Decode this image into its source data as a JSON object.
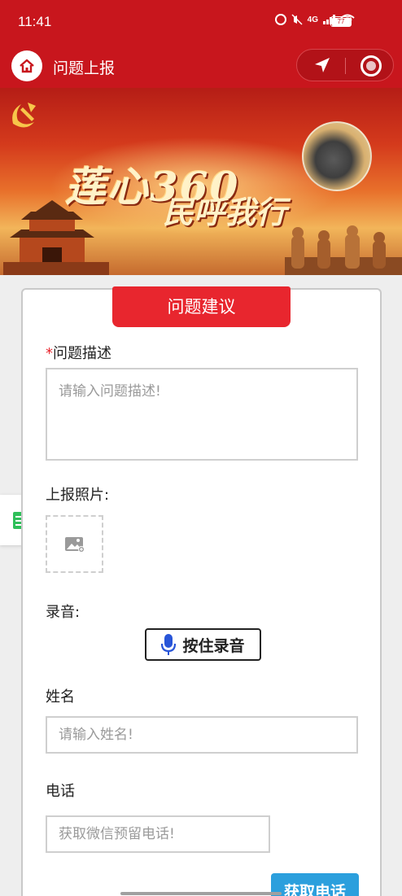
{
  "status_bar": {
    "time": "11:41",
    "network": "4G",
    "battery": "77"
  },
  "nav": {
    "title": "问题上报"
  },
  "banner": {
    "slogan_line1": "莲心360",
    "slogan_line2": "民呼我行"
  },
  "form": {
    "tab_title": "问题建议",
    "description": {
      "required_mark": "*",
      "label": "问题描述",
      "placeholder": "请输入问题描述!"
    },
    "photo": {
      "label": "上报照片:"
    },
    "recording": {
      "label": "录音:",
      "button": "按住录音"
    },
    "name": {
      "label": "姓名",
      "placeholder": "请输入姓名!"
    },
    "phone": {
      "label": "电话",
      "placeholder": "获取微信预留电话!",
      "fetch_button": "获取电话"
    }
  },
  "colors": {
    "brand_red": "#c8161d",
    "tab_red": "#e8262e",
    "action_blue": "#2b9fdd",
    "required_red": "#e8262e"
  }
}
